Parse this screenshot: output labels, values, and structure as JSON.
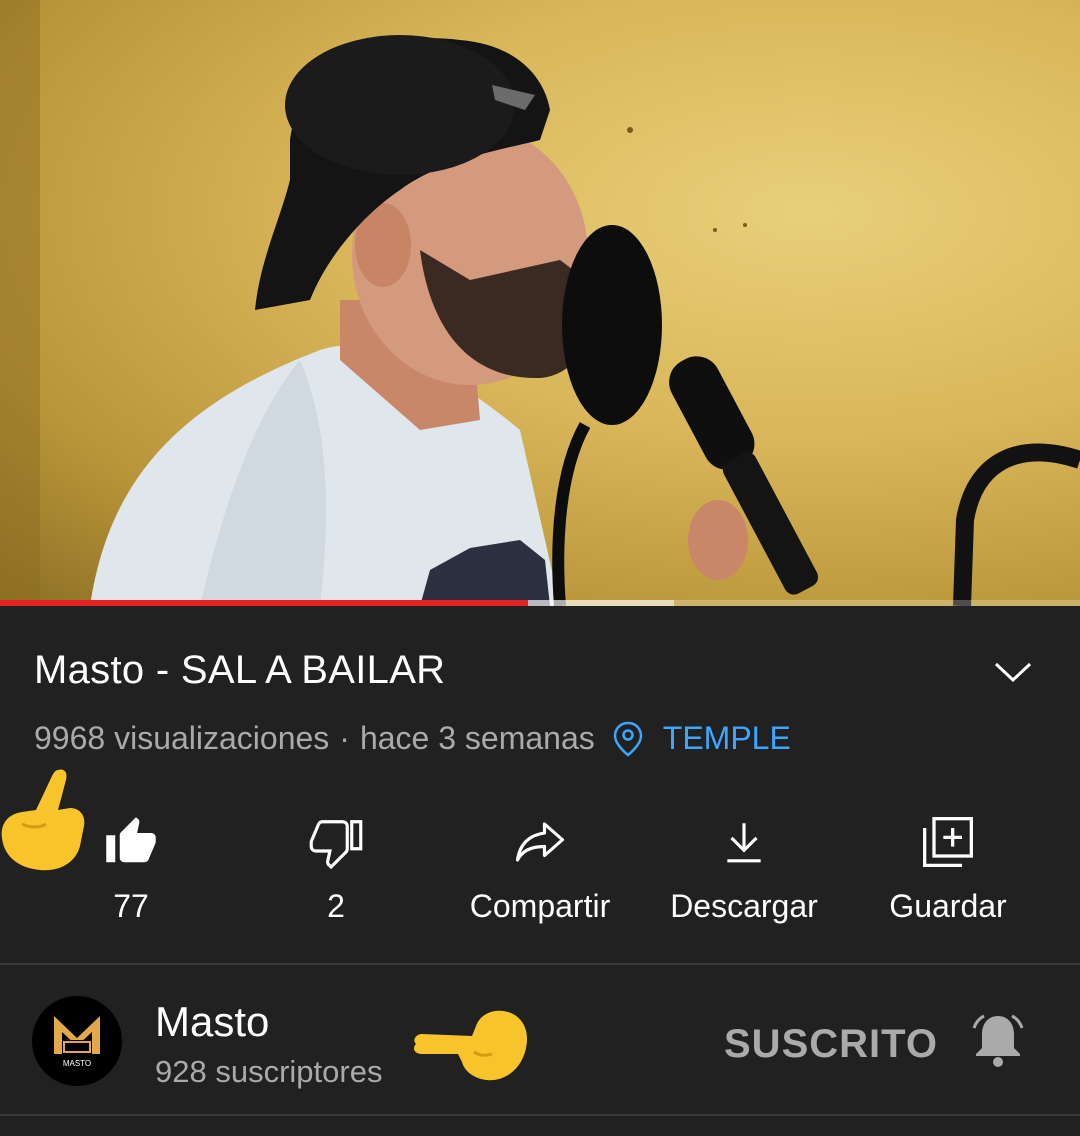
{
  "player": {
    "progress_fraction": 0.489,
    "buffered_fraction": 0.624,
    "colors": {
      "progress": "#e32222",
      "wall": "#dcbb5c"
    }
  },
  "video": {
    "title": "Masto - SAL A BAILAR",
    "views": "9968 visualizaciones",
    "separator": "·",
    "age": "hace 3 semanas",
    "location": "TEMPLE",
    "location_icon": "location-pin-icon",
    "expand_icon": "chevron-down-icon"
  },
  "actions": [
    {
      "icon": "thumbs-up-icon",
      "label": "77"
    },
    {
      "icon": "thumbs-down-icon",
      "label": "2"
    },
    {
      "icon": "share-icon",
      "label": "Compartir"
    },
    {
      "icon": "download-icon",
      "label": "Descargar"
    },
    {
      "icon": "save-playlist-icon",
      "label": "Guardar"
    }
  ],
  "channel": {
    "name": "Masto",
    "subscribers": "928 suscriptores",
    "avatar_text": "MASTO",
    "subscribe_label": "SUSCRITO",
    "bell_icon": "notification-bell-icon"
  },
  "colors": {
    "background": "#212121",
    "text_primary": "#ffffff",
    "text_secondary": "#aaaaaa",
    "link": "#3ea6ff",
    "emoji_hand": "#f7c52b"
  }
}
